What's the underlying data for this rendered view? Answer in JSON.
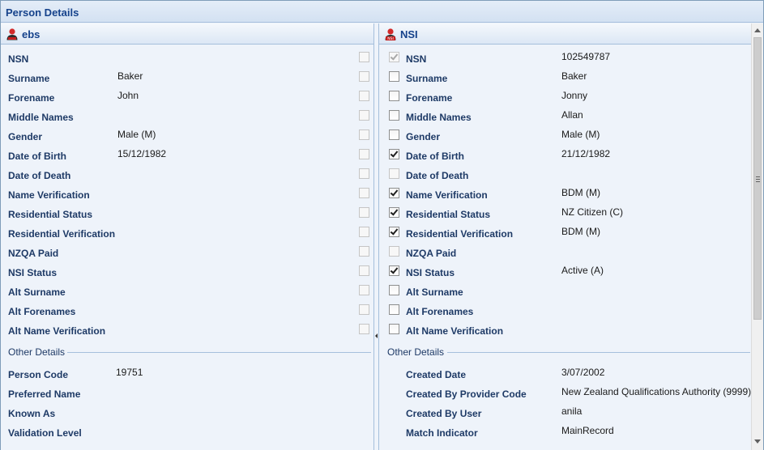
{
  "window": {
    "title": "Person Details"
  },
  "left": {
    "header": "ebs",
    "fields": [
      {
        "label": "NSN",
        "value": ""
      },
      {
        "label": "Surname",
        "value": "Baker"
      },
      {
        "label": "Forename",
        "value": "John"
      },
      {
        "label": "Middle Names",
        "value": ""
      },
      {
        "label": "Gender",
        "value": "Male (M)"
      },
      {
        "label": "Date of Birth",
        "value": "15/12/1982"
      },
      {
        "label": "Date of Death",
        "value": ""
      },
      {
        "label": "Name Verification",
        "value": ""
      },
      {
        "label": "Residential Status",
        "value": ""
      },
      {
        "label": "Residential Verification",
        "value": ""
      },
      {
        "label": "NZQA Paid",
        "value": ""
      },
      {
        "label": "NSI Status",
        "value": ""
      },
      {
        "label": "Alt Surname",
        "value": ""
      },
      {
        "label": "Alt Forenames",
        "value": ""
      },
      {
        "label": "Alt Name Verification",
        "value": ""
      }
    ],
    "other_title": "Other Details",
    "other": [
      {
        "label": "Person Code",
        "value": "19751"
      },
      {
        "label": "Preferred Name",
        "value": ""
      },
      {
        "label": "Known As",
        "value": ""
      },
      {
        "label": "Validation Level",
        "value": ""
      }
    ]
  },
  "right": {
    "header": "NSI",
    "fields": [
      {
        "label": "NSN",
        "value": "102549787",
        "checked": true,
        "disabled": true
      },
      {
        "label": "Surname",
        "value": "Baker",
        "checked": false,
        "disabled": false
      },
      {
        "label": "Forename",
        "value": "Jonny",
        "checked": false,
        "disabled": false
      },
      {
        "label": "Middle Names",
        "value": "Allan",
        "checked": false,
        "disabled": false
      },
      {
        "label": "Gender",
        "value": "Male (M)",
        "checked": false,
        "disabled": false
      },
      {
        "label": "Date of Birth",
        "value": "21/12/1982",
        "checked": true,
        "disabled": false
      },
      {
        "label": "Date of Death",
        "value": "",
        "checked": false,
        "disabled": true
      },
      {
        "label": "Name Verification",
        "value": "BDM (M)",
        "checked": true,
        "disabled": false
      },
      {
        "label": "Residential Status",
        "value": "NZ Citizen (C)",
        "checked": true,
        "disabled": false
      },
      {
        "label": "Residential Verification",
        "value": "BDM (M)",
        "checked": true,
        "disabled": false
      },
      {
        "label": "NZQA Paid",
        "value": "",
        "checked": false,
        "disabled": true
      },
      {
        "label": "NSI Status",
        "value": "Active (A)",
        "checked": true,
        "disabled": false
      },
      {
        "label": "Alt Surname",
        "value": "",
        "checked": false,
        "disabled": false
      },
      {
        "label": "Alt Forenames",
        "value": "",
        "checked": false,
        "disabled": false
      },
      {
        "label": "Alt Name Verification",
        "value": "",
        "checked": false,
        "disabled": false
      }
    ],
    "other_title": "Other Details",
    "other": [
      {
        "label": "Created Date",
        "value": "3/07/2002"
      },
      {
        "label": "Created By Provider Code",
        "value": "New Zealand Qualifications Authority (9999)"
      },
      {
        "label": "Created By User",
        "value": "anila"
      },
      {
        "label": "Match Indicator",
        "value": "MainRecord"
      }
    ]
  },
  "colors": {
    "accent": "#15428b",
    "background": "#eef3fa",
    "border": "#a5bfdc"
  },
  "icons": {
    "person": "person-icon",
    "nsi": "nsi-person-icon"
  }
}
